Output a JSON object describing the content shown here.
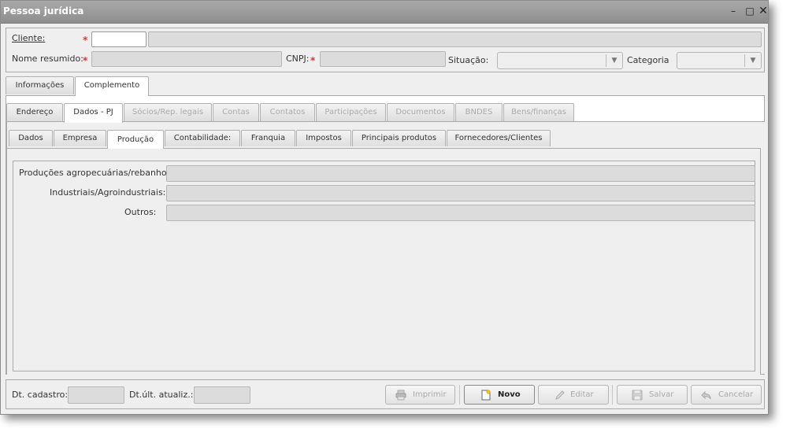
{
  "window": {
    "title": "Pessoa jurídica"
  },
  "header": {
    "cliente_label": "Cliente:",
    "nome_label": "Nome resumido:",
    "cnpj_label": "CNPJ:",
    "situacao_label": "Situação:",
    "categoria_label": "Categoria",
    "required_mark": "*"
  },
  "tabs_main": [
    {
      "label": "Informações",
      "active": false
    },
    {
      "label": "Complemento",
      "active": true
    }
  ],
  "tabs_level2": [
    {
      "label": "Endereço",
      "state": "normal"
    },
    {
      "label": "Dados - PJ",
      "state": "active"
    },
    {
      "label": "Sócios/Rep. legais",
      "state": "disabled"
    },
    {
      "label": "Contas",
      "state": "disabled"
    },
    {
      "label": "Contatos",
      "state": "disabled"
    },
    {
      "label": "Participações",
      "state": "disabled"
    },
    {
      "label": "Documentos",
      "state": "disabled"
    },
    {
      "label": "BNDES",
      "state": "disabled"
    },
    {
      "label": "Bens/finanças",
      "state": "disabled"
    }
  ],
  "tabs_level3": [
    {
      "label": "Dados",
      "active": false
    },
    {
      "label": "Empresa",
      "active": false
    },
    {
      "label": "Produção",
      "active": true
    },
    {
      "label": "Contabilidade:",
      "active": false
    },
    {
      "label": "Franquia",
      "active": false
    },
    {
      "label": "Impostos",
      "active": false
    },
    {
      "label": "Principais produtos",
      "active": false
    },
    {
      "label": "Fornecedores/Clientes",
      "active": false
    }
  ],
  "producao": {
    "agro_label": "Produções agropecuárias/rebanho:",
    "industriais_label": "Industriais/Agroindustriais:",
    "outros_label": "Outros:"
  },
  "footer": {
    "dt_cadastro_label": "Dt. cadastro:",
    "dt_atualiz_label": "Dt.últ. atualiz.:",
    "buttons": {
      "imprimir": "Imprimir",
      "novo": "Novo",
      "editar": "Editar",
      "salvar": "Salvar",
      "cancelar": "Cancelar"
    }
  }
}
